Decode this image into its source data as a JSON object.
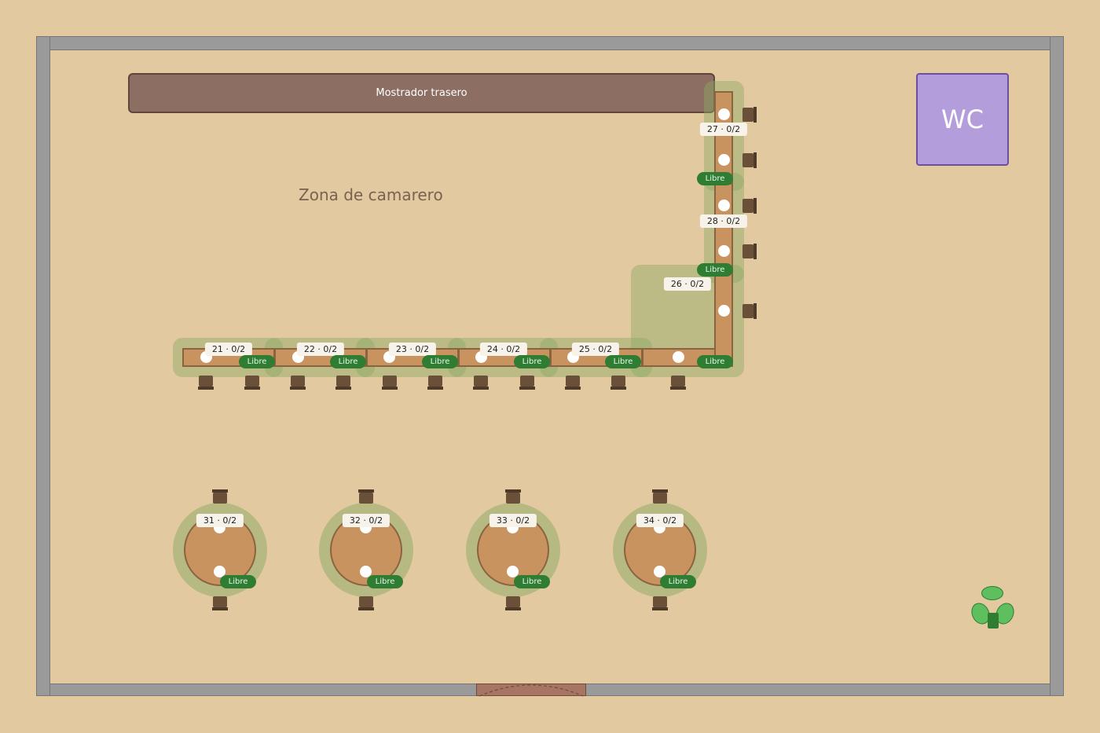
{
  "counter": {
    "label": "Mostrador trasero"
  },
  "wc": {
    "label": "WC"
  },
  "zone": {
    "label": "Zona de camarero"
  },
  "bar_tables": [
    {
      "label": "21 · 0/2",
      "status": "Libre"
    },
    {
      "label": "22 · 0/2",
      "status": "Libre"
    },
    {
      "label": "23 · 0/2",
      "status": "Libre"
    },
    {
      "label": "24 · 0/2",
      "status": "Libre"
    },
    {
      "label": "25 · 0/2",
      "status": "Libre"
    },
    {
      "label": "26 · 0/2",
      "status": "Libre"
    },
    {
      "label": "27 · 0/2",
      "status": "Libre"
    },
    {
      "label": "28 · 0/2",
      "status": "Libre"
    }
  ],
  "round_tables": [
    {
      "label": "31 · 0/2",
      "status": "Libre"
    },
    {
      "label": "32 · 0/2",
      "status": "Libre"
    },
    {
      "label": "33 · 0/2",
      "status": "Libre"
    },
    {
      "label": "34 · 0/2",
      "status": "Libre"
    }
  ],
  "colors": {
    "floor": "#e3c9a0",
    "wall": "#9a9a9a",
    "table": "#c9935f",
    "free_badge": "#2e7d32",
    "wc": "#b39ddb",
    "counter": "#8c6e62"
  },
  "icons": {
    "plant": "plant-icon",
    "door": "door-icon"
  }
}
